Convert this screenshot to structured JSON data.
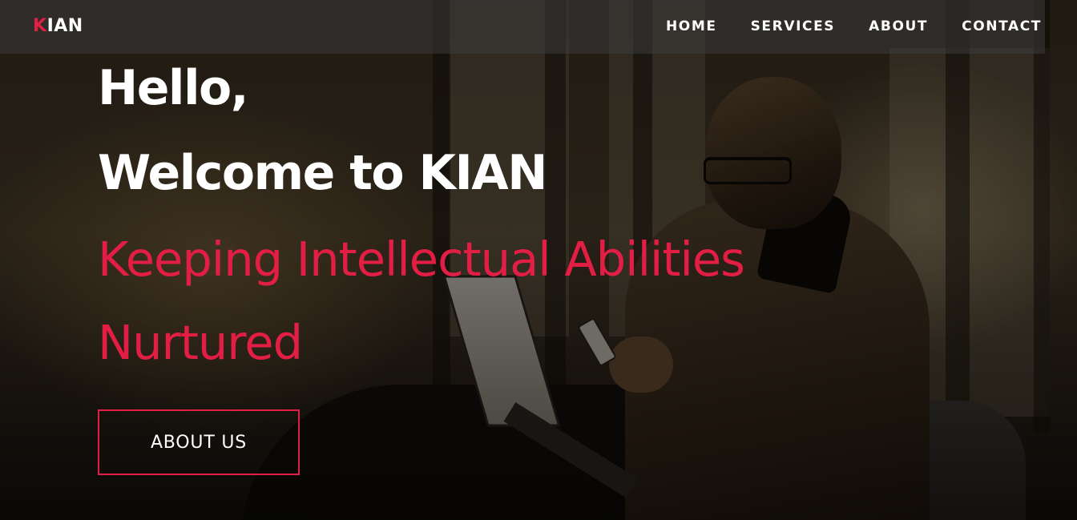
{
  "brand": {
    "logo_first_letter": "K",
    "logo_rest": "IAN",
    "accent_color": "#e31e44"
  },
  "nav": {
    "items": [
      {
        "label": "HOME"
      },
      {
        "label": "SERVICES"
      },
      {
        "label": "ABOUT"
      },
      {
        "label": "CONTACT"
      }
    ]
  },
  "hero": {
    "greeting": "Hello,",
    "welcome": "Welcome to KIAN",
    "tagline_line1": "Keeping Intellectual Abilities",
    "tagline_line2": "Nurtured",
    "cta_label": "ABOUT US"
  }
}
